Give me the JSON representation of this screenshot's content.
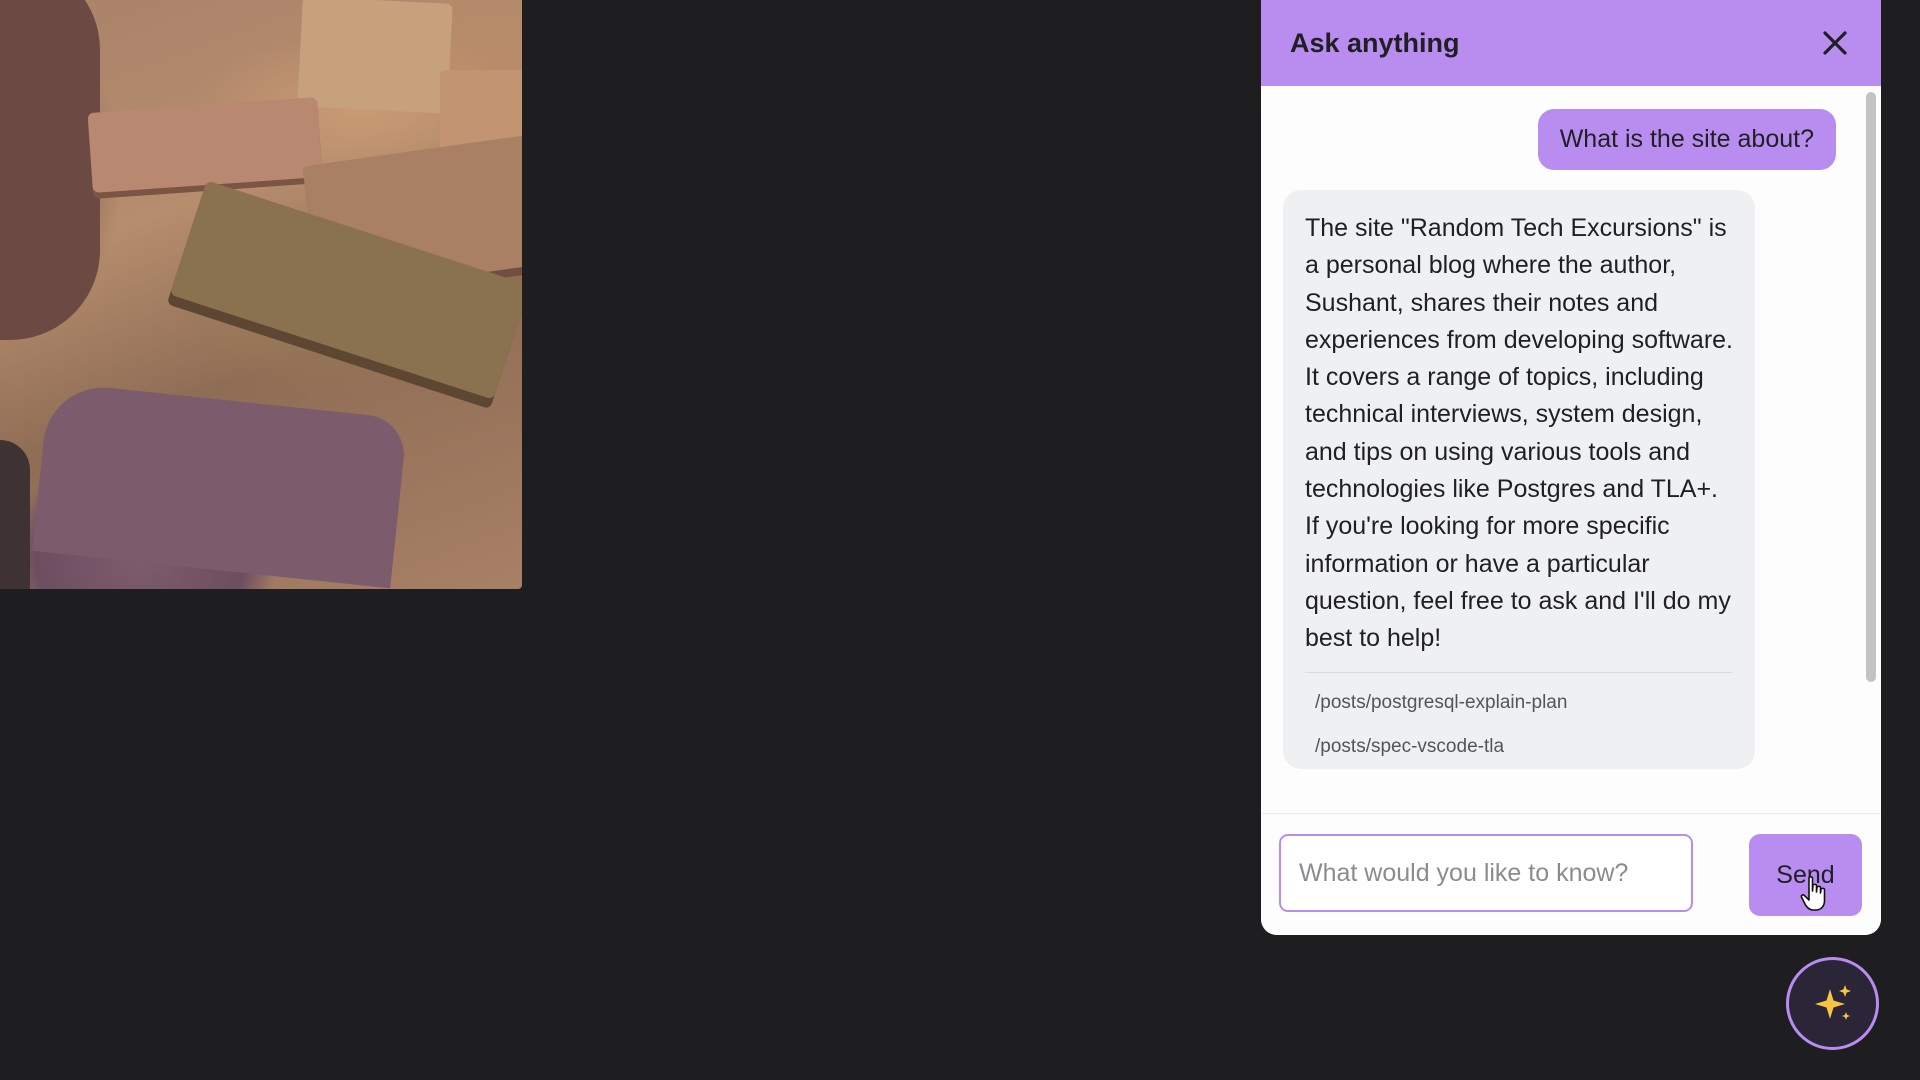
{
  "chat": {
    "title": "Ask anything",
    "user_message": "What is the site about?",
    "bot_message": "The site \"Random Tech Excursions\" is a personal blog where the author, Sushant, shares their notes and experiences from developing software. It covers a range of topics, including technical interviews, system design, and tips on using various tools and technologies like Postgres and TLA+. If you're looking for more specific information or have a particular question, feel free to ask and I'll do my best to help!",
    "sources": [
      "/posts/postgresql-explain-plan",
      "/posts/spec-vscode-tla"
    ],
    "input_placeholder": "What would you like to know?",
    "send_label": "Send"
  },
  "colors": {
    "accent": "#b98df0",
    "page_background": "#1e1e21",
    "bot_bubble": "#eff0f1"
  },
  "icons": {
    "close": "close-icon",
    "launcher": "sparkles-icon",
    "cursor": "hand-pointer-icon"
  }
}
